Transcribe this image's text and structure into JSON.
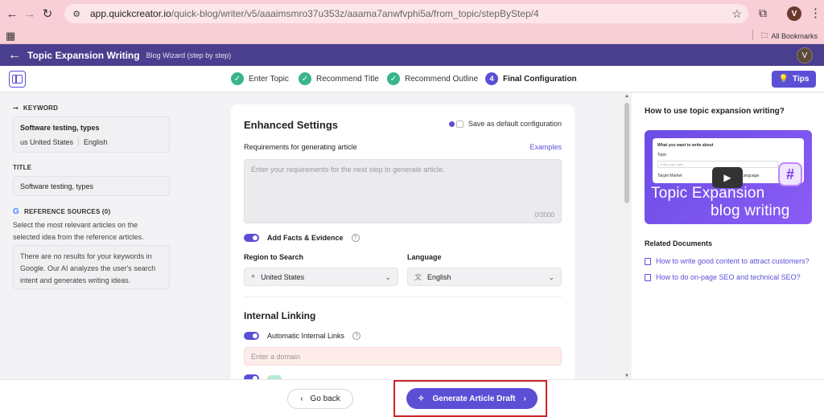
{
  "browser": {
    "url_host": "app.quickcreator.io",
    "url_path": "/quick-blog/writer/v5/aaaimsmro37u353z/aaama7anwfvphi5a/from_topic/stepByStep/4",
    "profile_initial": "V",
    "all_bookmarks_label": "All Bookmarks"
  },
  "header": {
    "title": "Topic Expansion Writing",
    "subtitle": "Blog Wizard (step by step)",
    "avatar_initial": "V"
  },
  "steps": [
    {
      "label": "Enter Topic",
      "state": "done"
    },
    {
      "label": "Recommend Title",
      "state": "done"
    },
    {
      "label": "Recommend Outline",
      "state": "done"
    },
    {
      "label": "Final Configuration",
      "state": "active",
      "number": "4"
    }
  ],
  "tips_label": "Tips",
  "left": {
    "keyword_label": "KEYWORD",
    "keyword_value": "Software testing, types",
    "keyword_country": "us United States",
    "keyword_language": "English",
    "title_label": "TITLE",
    "title_value": "Software testing, types",
    "ref_label": "REFERENCE SOURCES (0)",
    "ref_desc": "Select the most relevant articles on the selected idea from the reference articles.",
    "ref_empty": "There are no results for your keywords in Google. Our AI analyzes the user's search intent and generates writing ideas."
  },
  "main": {
    "title": "Enhanced Settings",
    "save_default": "Save as default configuration",
    "req_label": "Requirements for generating article",
    "examples": "Examples",
    "req_placeholder": "Enter your requirements for the next step to generate article.",
    "req_count": "0/3000",
    "facts_label": "Add Facts & Evidence",
    "region_label": "Region to Search",
    "region_value": "United States",
    "language_label": "Language",
    "language_value": "English",
    "internal_title": "Internal Linking",
    "auto_links_label": "Automatic Internal Links",
    "domain_placeholder": "Enter a domain"
  },
  "right": {
    "title": "How to use topic expansion writing?",
    "video_line1": "What you want to write about",
    "video_topic": "Topic",
    "video_input": "Enter your topic",
    "video_target": "Target Market",
    "video_lang": "Language",
    "video_big1": "Topic Expansion",
    "video_big2": "blog writing",
    "related_title": "Related Documents",
    "docs": [
      "How to write good content to attract customers?",
      "How to do on-page SEO and technical SEO?"
    ]
  },
  "footer": {
    "go_back": "Go back",
    "generate": "Generate Article Draft"
  },
  "colors": {
    "accent": "#5b4fd6",
    "header": "#4a3f8e",
    "success": "#38b58a",
    "highlight_outline": "#d0212a"
  }
}
